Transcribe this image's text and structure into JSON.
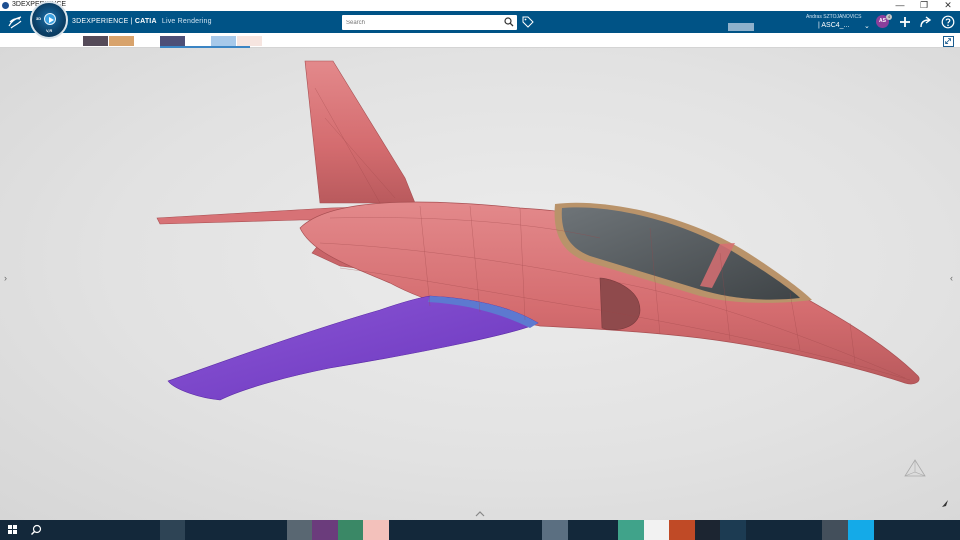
{
  "window": {
    "title": "3DEXPERIENCE",
    "controls": [
      "—",
      "❐",
      "✕"
    ]
  },
  "topbar": {
    "brand": "3DEXPERIENCE",
    "separator": "|",
    "app": "CATIA",
    "app_module": "Live Rendering",
    "search_placeholder": "Search",
    "user_name": "Andras SZTOJANOVICS",
    "tenant": "| ASC4_...",
    "avatar_initials": "AS",
    "avatar_badge": "4",
    "compass_labels": {
      "v6": "V,R",
      "top": "3D"
    },
    "background_color": "#005386"
  },
  "action_bar": {
    "swatch_colors": [
      "#554b59",
      "#d8a36c",
      "#4d4f77",
      "#a7c9ea",
      "#f6e5e0"
    ]
  },
  "viewport": {
    "model": "jet trainer aircraft",
    "fuselage_color": "#d76f72",
    "wing_highlight_color": "#7a45c9",
    "canopy_color": "#545a5e",
    "canopy_frame_color": "#b9936a"
  },
  "taskbar": {
    "items_colors": [
      "#2e4455",
      "#596772",
      "#6b3c7c",
      "#3a8866",
      "#f3c1bb",
      "#5b6f81",
      "#40a38a",
      "#f2f2f2",
      "#c04a26",
      "#1c2531",
      "#1c3b52",
      "#434f5b",
      "#14aae8"
    ]
  }
}
